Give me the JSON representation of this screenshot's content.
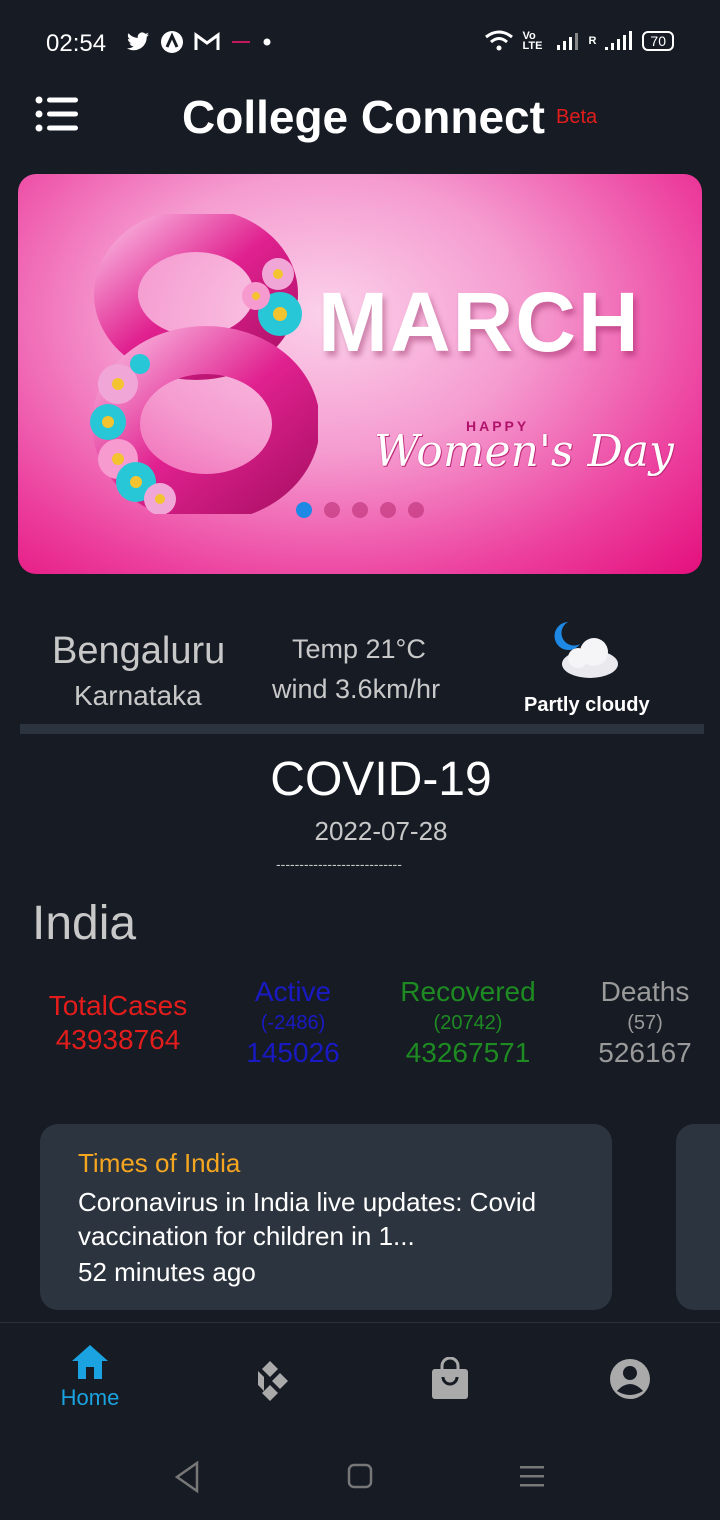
{
  "status_bar": {
    "time": "02:54",
    "battery": "70",
    "volte_label": "Vo LTE",
    "roaming_label": "R"
  },
  "app": {
    "title": "College Connect",
    "badge": "Beta"
  },
  "banner": {
    "headline": "MARCH",
    "numeral": "8",
    "tagline_small": "HAPPY",
    "tagline_script": "Women's Day",
    "dot_count": 5,
    "active_dot": 0
  },
  "weather": {
    "city": "Bengaluru",
    "state": "Karnataka",
    "temp": "Temp 21°C",
    "wind": "wind 3.6km/hr",
    "condition": "Partly cloudy",
    "icon": "night-partly-cloudy-icon"
  },
  "covid": {
    "title": "COVID-19",
    "date": "2022-07-28",
    "separator": "---------------------------",
    "country": "India",
    "stats": {
      "total": {
        "label": "TotalCases",
        "value": "43938764"
      },
      "active": {
        "label": "Active",
        "delta": "(-2486)",
        "value": "145026"
      },
      "recovered": {
        "label": "Recovered",
        "delta": "(20742)",
        "value": "43267571"
      },
      "deaths": {
        "label": "Deaths",
        "delta": "(57)",
        "value": "526167"
      }
    }
  },
  "news": [
    {
      "source": "Times of India",
      "headline": "Coronavirus in India live updates: Covid vaccination for children in 1...",
      "time": "52 minutes ago"
    }
  ],
  "bottom_nav": {
    "home_label": "Home",
    "items": [
      "home-icon",
      "kodi-icon",
      "shopping-bag-icon",
      "account-icon"
    ]
  },
  "colors": {
    "background": "#161b24",
    "card": "#2c343f",
    "accent": "#1aa3e0",
    "total": "#e31c1c",
    "active": "#1a1ac4",
    "recovered": "#1e8a22",
    "deaths": "#9a9a9a",
    "news_source": "#f4a620"
  }
}
